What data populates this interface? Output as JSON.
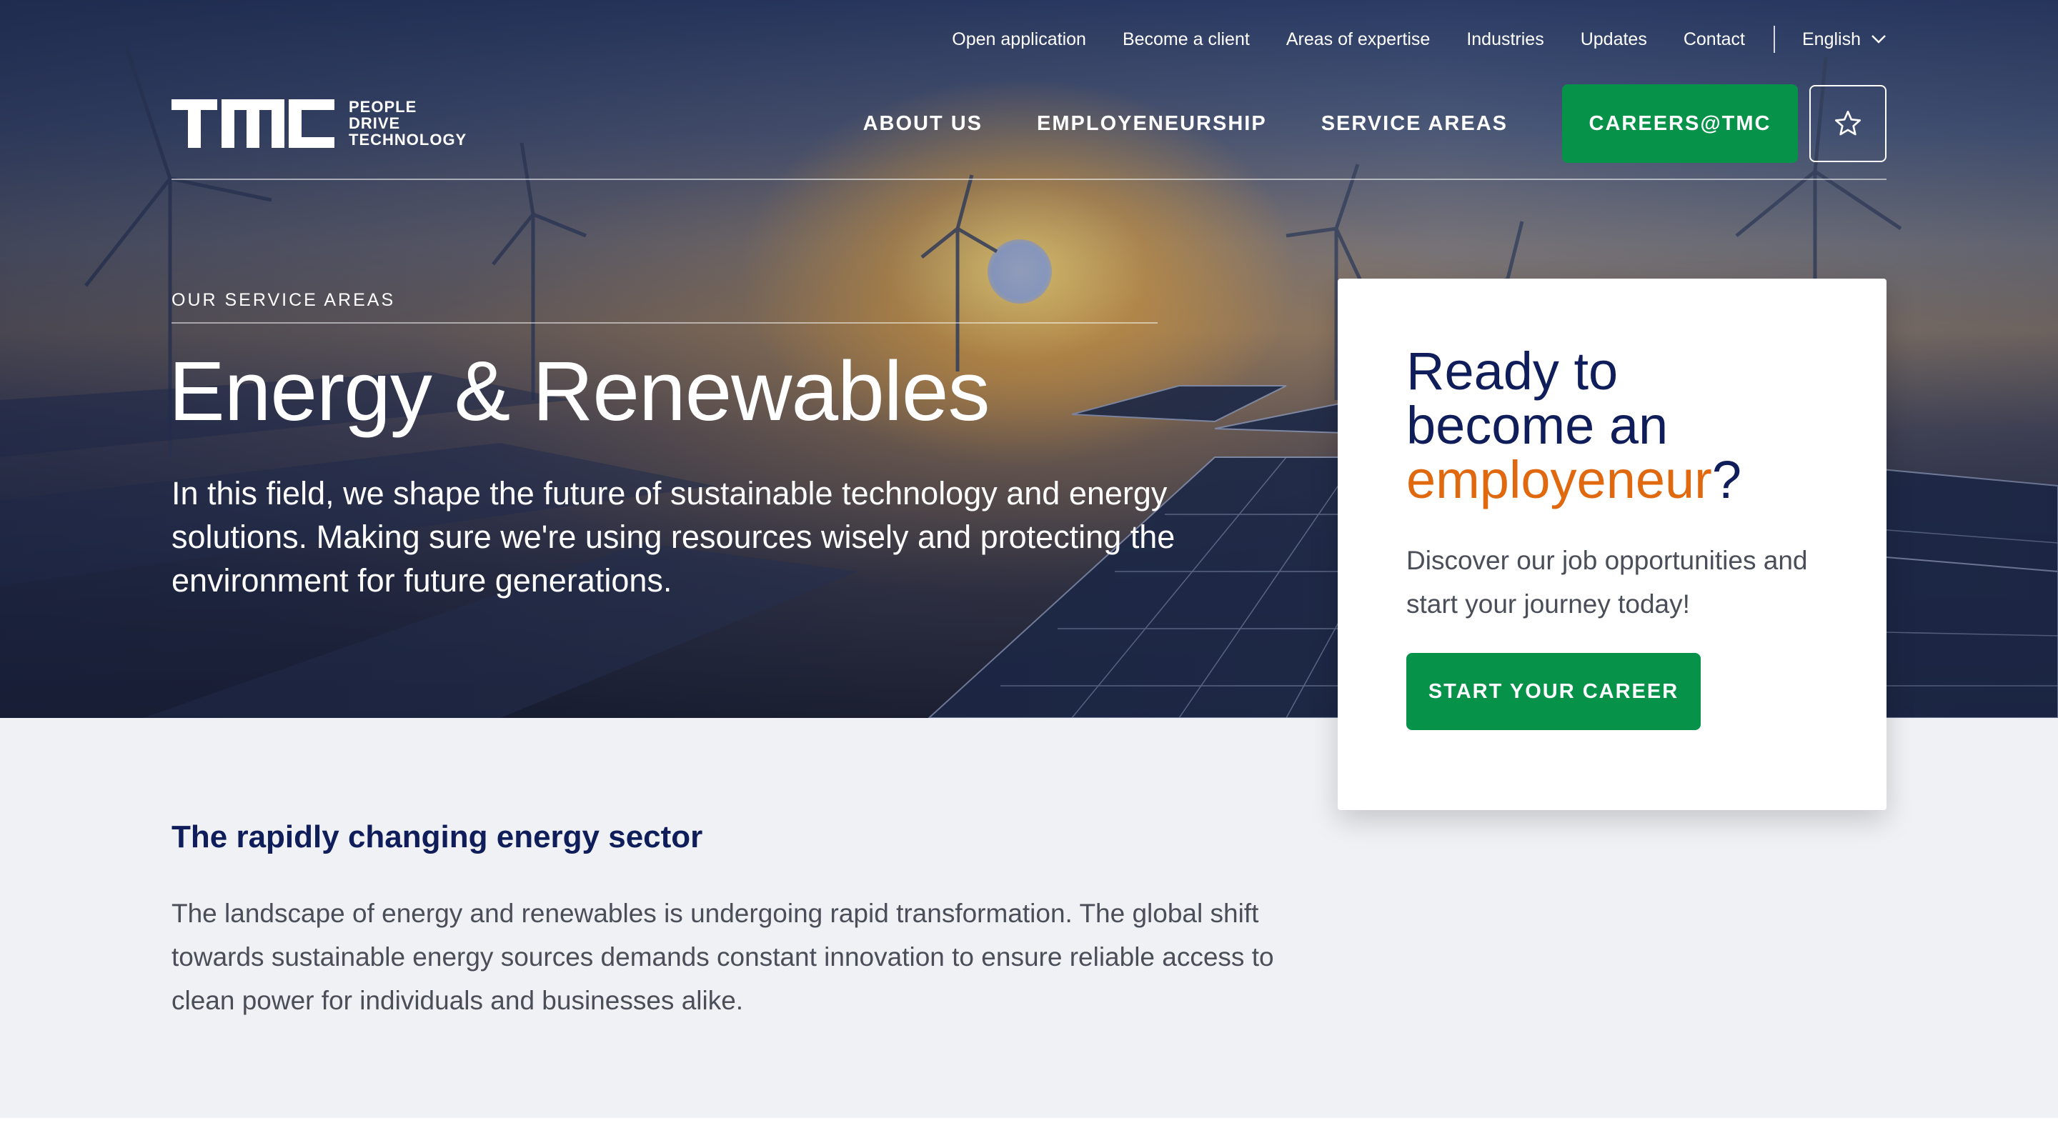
{
  "top_nav": {
    "items": [
      {
        "label": "Open application"
      },
      {
        "label": "Become a client"
      },
      {
        "label": "Areas of expertise"
      },
      {
        "label": "Industries"
      },
      {
        "label": "Updates"
      },
      {
        "label": "Contact"
      }
    ],
    "language": "English"
  },
  "logo": {
    "tagline": [
      "PEOPLE",
      "DRIVE",
      "TECHNOLOGY"
    ]
  },
  "main_nav": {
    "items": [
      {
        "label": "ABOUT US"
      },
      {
        "label": "EMPLOYENEURSHIP"
      },
      {
        "label": "SERVICE AREAS"
      }
    ],
    "careers_label": "CAREERS@TMC"
  },
  "hero": {
    "eyebrow": "OUR SERVICE AREAS",
    "title": "Energy & Renewables",
    "intro": "In this field, we shape the future of sustainable technology and energy solutions. Making sure we're using resources wisely and protecting the environment for future generations."
  },
  "cta_card": {
    "title_line1": "Ready to",
    "title_line2": "become an",
    "title_accent": "employeneur",
    "title_end": "?",
    "text": "Discover our job opportunities and start your journey today!",
    "button_label": "START YOUR CAREER"
  },
  "section": {
    "title": "The rapidly changing energy sector",
    "body": "The landscape of energy and renewables is undergoing rapid transformation. The global shift towards sustainable energy sources demands constant innovation to ensure reliable access to clean power for individuals and businesses alike."
  },
  "colors": {
    "brand_green": "#07924a",
    "navy": "#0f1d5a",
    "accent_orange": "#e0680f",
    "section_bg": "#eff1f4"
  },
  "icons": [
    "chevron-down-icon",
    "star-icon",
    "tmc-logo"
  ]
}
